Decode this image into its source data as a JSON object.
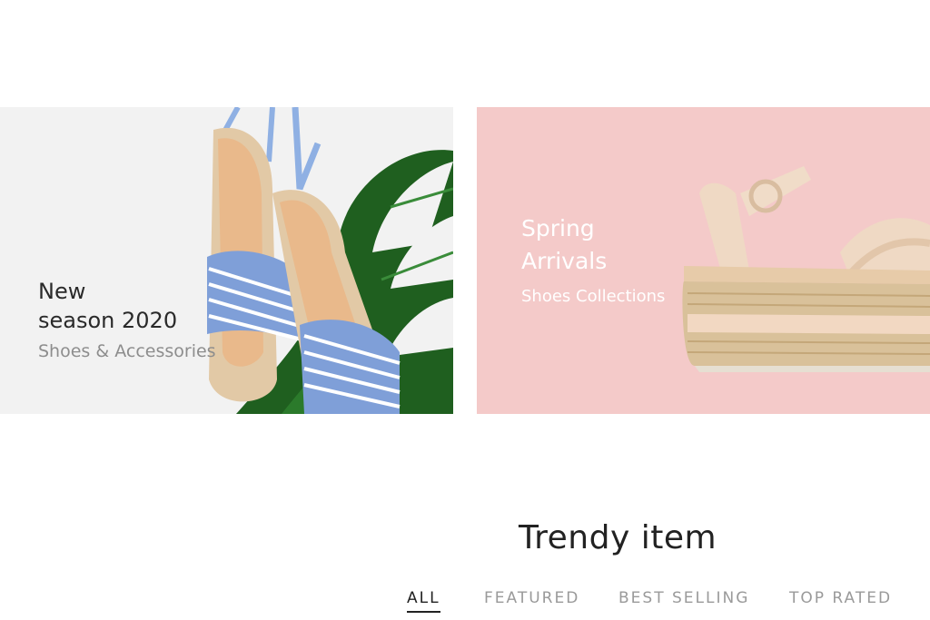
{
  "banners": {
    "left": {
      "line1": "New",
      "line2": "season 2020",
      "line3": "Shoes & Accessories",
      "bg": "#f2f2f2",
      "image": "striped-espadrille-sandals-with-monstera-leaf"
    },
    "right": {
      "line1": "Spring",
      "line2": "Arrivals",
      "line3": "Shoes Collections",
      "bg": "#f4cac9",
      "image": "beige-platform-espadrille-sandal"
    }
  },
  "section": {
    "title": "Trendy item"
  },
  "tabs": [
    {
      "label": "ALL",
      "active": true
    },
    {
      "label": "FEATURED",
      "active": false
    },
    {
      "label": "BEST SELLING",
      "active": false
    },
    {
      "label": "TOP RATED",
      "active": false
    }
  ],
  "colors": {
    "text_dark": "#222222",
    "text_muted": "#9a9a9a",
    "pink": "#f4cac9",
    "stripe_blue": "#7f9fd8"
  }
}
